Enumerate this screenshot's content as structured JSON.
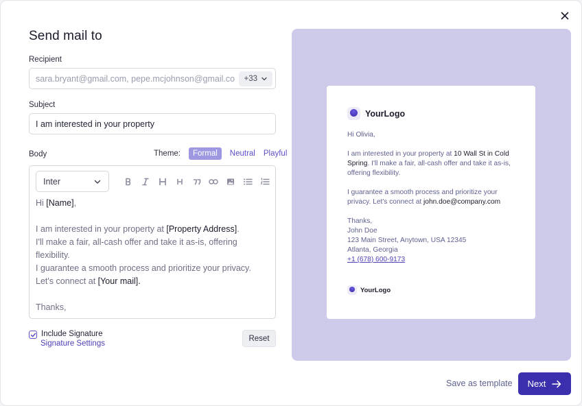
{
  "dialog": {
    "title": "Send mail to",
    "close_icon": "close-icon"
  },
  "recipient": {
    "label": "Recipient",
    "value": "sara.bryant@gmail.com, pepe.mcjohnson@gmail.com",
    "extra_count": "+33",
    "chevron_icon": "chevron-down-icon"
  },
  "subject": {
    "label": "Subject",
    "value": "I am interested in your property"
  },
  "body": {
    "label": "Body",
    "theme_label": "Theme:",
    "themes": [
      {
        "label": "Formal",
        "active": true
      },
      {
        "label": "Neutral",
        "active": false
      },
      {
        "label": "Playful",
        "active": false
      }
    ],
    "font": "Inter",
    "toolbar_icons": [
      "bold-icon",
      "italic-icon",
      "heading-1-icon",
      "heading-2-icon",
      "quote-icon",
      "link-icon",
      "image-icon",
      "bullet-list-icon",
      "numbered-list-icon"
    ],
    "text": {
      "l1_pre": "Hi ",
      "l1_tag": "[Name]",
      "l1_post": ",",
      "l2_pre": "I am interested in your property at ",
      "l2_tag": "[Property Address]",
      "l2_post": ".",
      "l3": "I'll make a fair, all-cash offer and take it as-is, offering flexibility.",
      "l4": "I guarantee a smooth process and prioritize your privacy.",
      "l5_pre": "Let's connect at ",
      "l5_tag": "[Your mail].",
      "l6": "Thanks,"
    }
  },
  "signature": {
    "checkbox_label": "Include Signature",
    "checked": true,
    "settings_link": "Signature Settings",
    "reset_label": "Reset"
  },
  "preview": {
    "logo_text": "YourLogo",
    "greeting": "Hi Olivia,",
    "p1_pre": "I am interested in your property at ",
    "p1_addr": "10 Wall St in Cold Spring",
    "p1_post": ". I'll make a fair, all-cash offer and take it as-is, offering flexibility.",
    "p2_pre": "I guarantee a smooth process and prioritize your privacy. Let's connect at ",
    "p2_mail": "john.doe@company.com",
    "sign_thanks": "Thanks,",
    "sign_name": "John Doe",
    "sign_address": "123 Main Street, Anytown, USA 12345",
    "sign_city": "Atlanta, Georgia",
    "sign_phone": "+1 (678) 600-9173",
    "footer_logo_text": "YourLogo"
  },
  "footer": {
    "save_template": "Save as template",
    "next": "Next",
    "next_icon": "arrow-right-icon"
  },
  "colors": {
    "accent": "#3b2fae",
    "preview_bg": "#cdcaea",
    "theme_active": "#9e98e2"
  }
}
